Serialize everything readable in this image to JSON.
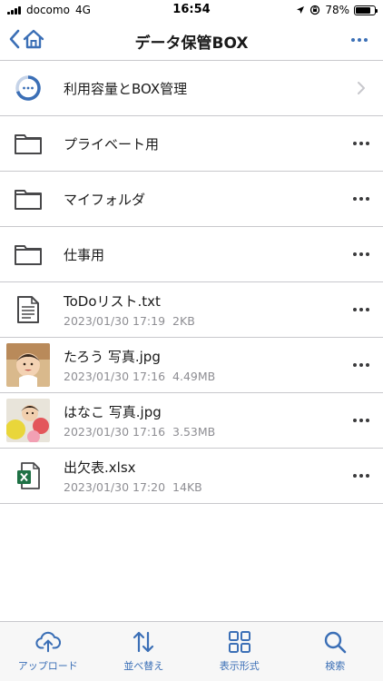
{
  "status_bar": {
    "carrier": "docomo",
    "network": "4G",
    "time": "16:54",
    "battery": "78%",
    "battery_level": 0.78
  },
  "navbar": {
    "title": "データ保管BOX"
  },
  "storage_row": {
    "label": "利用容量とBOX管理"
  },
  "folders": [
    {
      "name": "プライベート用"
    },
    {
      "name": "マイフォルダ"
    },
    {
      "name": "仕事用"
    }
  ],
  "files": [
    {
      "name": "ToDoリスト.txt",
      "date": "2023/01/30 17:19",
      "size": "2KB",
      "icon": "text-file-icon"
    },
    {
      "name": "たろう 写真.jpg",
      "date": "2023/01/30 17:16",
      "size": "4.49MB",
      "icon": "photo-thumbnail"
    },
    {
      "name": "はなこ 写真.jpg",
      "date": "2023/01/30 17:16",
      "size": "3.53MB",
      "icon": "photo-thumbnail"
    },
    {
      "name": "出欠表.xlsx",
      "date": "2023/01/30 17:20",
      "size": "14KB",
      "icon": "excel-file-icon"
    }
  ],
  "tabbar": {
    "upload": "アップロード",
    "sort": "並べ替え",
    "view": "表示形式",
    "search": "検索"
  },
  "colors": {
    "accent": "#3b6fb6",
    "excel_green": "#1e7145"
  }
}
